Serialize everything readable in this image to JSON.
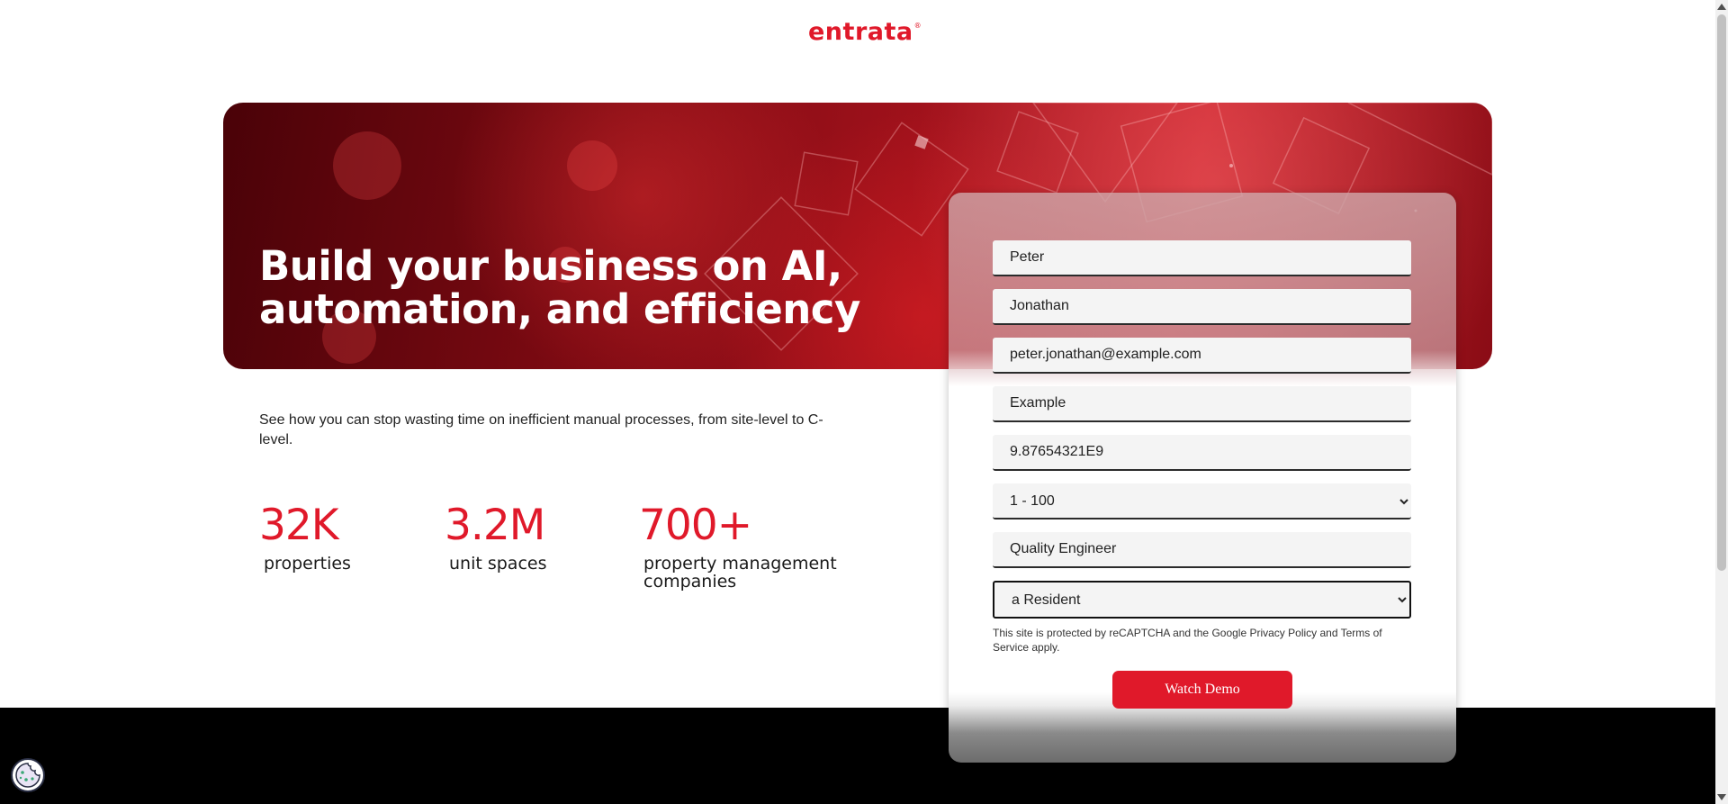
{
  "header": {
    "logo_text": "entrata",
    "logo_mark": "®"
  },
  "hero": {
    "title": "Build your business on AI, automation, and efficiency"
  },
  "description": "See how you can stop wasting time on inefficient manual processes, from site-level to C-level.",
  "stats": [
    {
      "value": "32K",
      "label": "properties"
    },
    {
      "value": "3.2M",
      "label": "unit spaces"
    },
    {
      "value": "700+",
      "label": "property management companies"
    }
  ],
  "form": {
    "first_name": "Peter",
    "last_name": "Jonathan",
    "email": "peter.jonathan@example.com",
    "company": "Example",
    "phone": "9.87654321E9",
    "unit_count": "1 - 100",
    "job_title": "Quality Engineer",
    "role": "a Resident",
    "recaptcha_text": "This site is protected by reCAPTCHA and the Google Privacy Policy and Terms of Service apply.",
    "submit_label": "Watch Demo"
  },
  "colors": {
    "accent": "#e0192a",
    "footer": "#000000",
    "text": "#1a1a1a"
  },
  "icons": {
    "cookie": "cookie-icon"
  }
}
